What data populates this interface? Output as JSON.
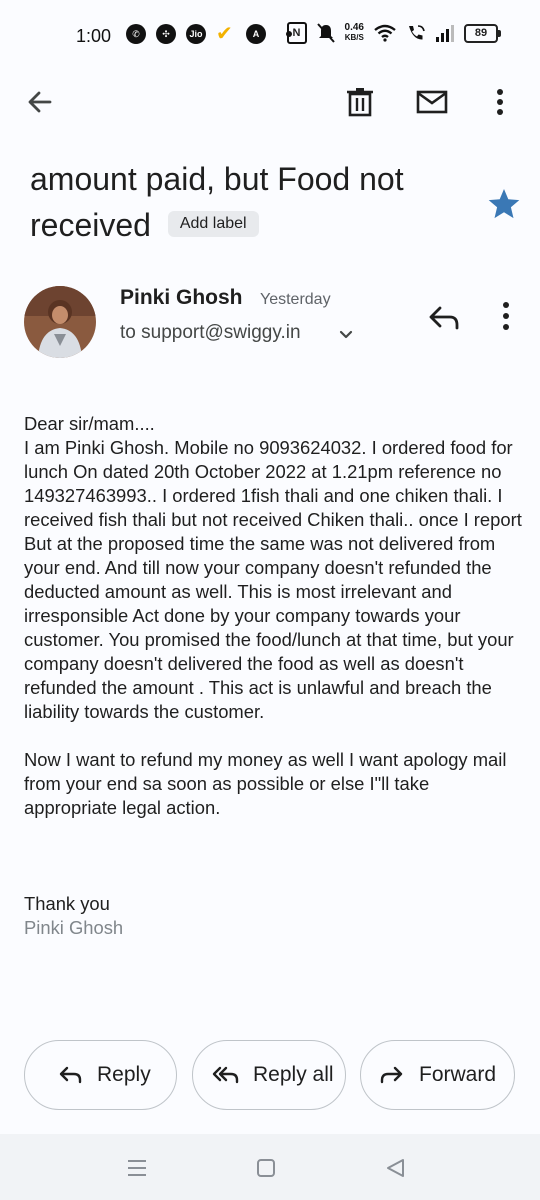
{
  "status_bar": {
    "time": "1:00",
    "net_speed_value": "0.46",
    "net_speed_unit": "KB/S",
    "battery": "89"
  },
  "email": {
    "subject": "amount paid, but Food not received",
    "add_label": "Add label",
    "starred": true,
    "sender_name": "Pinki Ghosh",
    "time": "Yesterday",
    "to": "to support@swiggy.in",
    "body_para1": "Dear sir/mam....\nI am Pinki Ghosh. Mobile no 9093624032. I ordered food for lunch On dated 20th October 2022 at 1.21pm reference no 149327463993.. I ordered 1fish thali and one chiken thali. I received fish thali but not received Chiken thali.. once I report But at the proposed time the same was not delivered from your end. And till now your company doesn't refunded the deducted amount as well. This is most irrelevant and irresponsible Act done by your company towards your customer. You promised the food/lunch at that time, but your company doesn't delivered the food as well as doesn't refunded the amount . This act is unlawful and breach the liability towards the customer.",
    "body_para2": "Now I want to refund my money as well I want apology mail from your end sa soon as possible or else I\"ll take appropriate legal action.",
    "sign_off": "Thank you",
    "signature_name": "Pinki Ghosh"
  },
  "actions": {
    "reply": "Reply",
    "reply_all": "Reply all",
    "forward": "Forward"
  },
  "colors": {
    "accent_star": "#3a78b5",
    "background": "#fbfcff"
  }
}
